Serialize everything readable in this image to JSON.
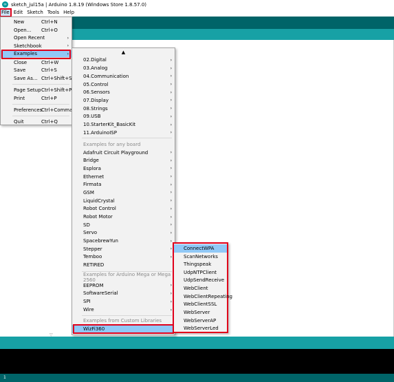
{
  "window": {
    "title": "sketch_jul15a | Arduino 1.8.19 (Windows Store 1.8.57.0)"
  },
  "menubar": [
    {
      "label": "File"
    },
    {
      "label": "Edit"
    },
    {
      "label": "Sketch"
    },
    {
      "label": "Tools"
    },
    {
      "label": "Help"
    }
  ],
  "file_menu": {
    "items": [
      {
        "label": "New",
        "shortcut": "Ctrl+N"
      },
      {
        "label": "Open...",
        "shortcut": "Ctrl+O"
      },
      {
        "label": "Open Recent",
        "shortcut": ""
      },
      {
        "label": "Sketchbook",
        "shortcut": ""
      },
      {
        "label": "Examples",
        "shortcut": ""
      },
      {
        "label": "Close",
        "shortcut": "Ctrl+W"
      },
      {
        "label": "Save",
        "shortcut": "Ctrl+S"
      },
      {
        "label": "Save As...",
        "shortcut": "Ctrl+Shift+S"
      },
      {
        "label": "Page Setup",
        "shortcut": "Ctrl+Shift+P"
      },
      {
        "label": "Print",
        "shortcut": "Ctrl+P"
      },
      {
        "label": "Preferences",
        "shortcut": "Ctrl+Comma"
      },
      {
        "label": "Quit",
        "shortcut": "Ctrl+Q"
      }
    ]
  },
  "examples_menu": {
    "scroll_up": "▲",
    "scroll_down": "▽",
    "builtin": [
      "02.Digital",
      "03.Analog",
      "04.Communication",
      "05.Control",
      "06.Sensors",
      "07.Display",
      "08.Strings",
      "09.USB",
      "10.StarterKit_BasicKit",
      "11.ArduinoISP"
    ],
    "any_board_header": "Examples for any board",
    "any_board": [
      "Adafruit Circuit Playground",
      "Bridge",
      "Esplora",
      "Ethernet",
      "Firmata",
      "GSM",
      "LiquidCrystal",
      "Robot Control",
      "Robot Motor",
      "SD",
      "Servo",
      "SpacebrewYun",
      "Stepper",
      "Temboo",
      "RETIRED"
    ],
    "mega_header": "Examples for Arduino Mega or Mega 2560",
    "mega": [
      "EEPROM",
      "SoftwareSerial",
      "SPI",
      "Wire"
    ],
    "custom_header": "Examples from Custom Libraries",
    "custom": [
      "WizFi360"
    ]
  },
  "wizfi_menu": {
    "items": [
      "ConnectWPA",
      "ScanNetworks",
      "Thingspeak",
      "UdpNTPClient",
      "UdpSendReceive",
      "WebClient",
      "WebClientRepeating",
      "WebClientSSL",
      "WebServer",
      "WebServerAP",
      "WebServerLed"
    ]
  },
  "statusbar": {
    "line": "1"
  },
  "colors": {
    "teal_dark": "#006468",
    "teal_light": "#17a1a5",
    "highlight": "#91c9f7",
    "annotation_red": "#e0001a"
  }
}
